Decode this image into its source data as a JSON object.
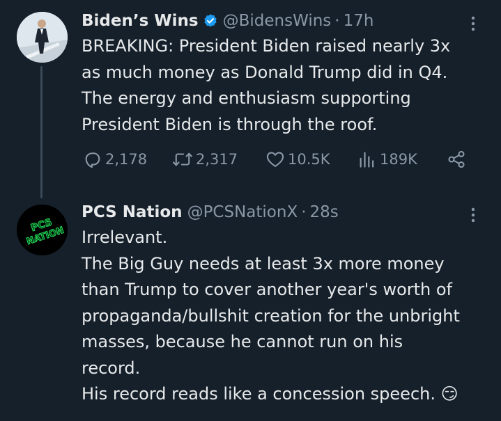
{
  "tweets": [
    {
      "display_name": "Biden’s Wins",
      "verified": true,
      "handle": "@BidensWins",
      "separator": "·",
      "time": "17h",
      "text": "BREAKING: President Biden raised nearly 3x\nas much money as Donald Trump did in Q4.\nThe energy and enthusiasm supporting\nPresident Biden is through the roof.",
      "stats": {
        "replies": "2,178",
        "reposts": "2,317",
        "likes": "10.5K",
        "views": "189K"
      }
    },
    {
      "display_name": "PCS Nation",
      "verified": false,
      "handle": "@PCSNationX",
      "separator": "·",
      "time": "28s",
      "avatar_text": "PCS NATION",
      "text": "Irrelevant.\nThe Big Guy needs at least 3x more money\nthan Trump to cover another year's worth of\npropaganda/bullshit creation for the unbright\nmasses, because he cannot run on his\nrecord.\nHis record reads like a concession speech. 😏"
    }
  ],
  "colors": {
    "background": "#15202b",
    "text": "#e7e9ea",
    "muted": "#8b98a5",
    "verified": "#1d9bf0",
    "avatar_text": "#1fd655"
  },
  "icons": {
    "verified": "verified-badge-icon",
    "more": "more-vertical-icon",
    "reply": "reply-icon",
    "repost": "repost-icon",
    "like": "heart-icon",
    "views": "views-bar-chart-icon",
    "share": "share-icon"
  }
}
